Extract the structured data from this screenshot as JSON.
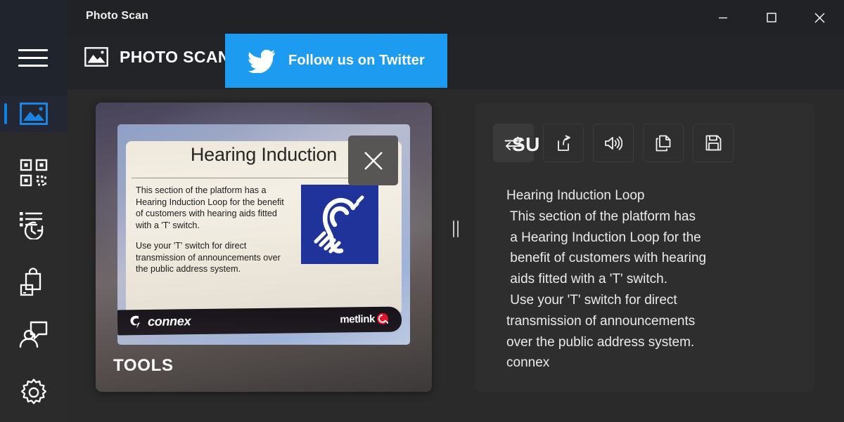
{
  "window": {
    "title": "Photo Scan",
    "controls": [
      {
        "name": "minimize",
        "glyph": "minimize-icon"
      },
      {
        "name": "maximize",
        "glyph": "maximize-icon"
      },
      {
        "name": "close",
        "glyph": "close-icon"
      }
    ]
  },
  "colors": {
    "accent_blue": "#0a84e0",
    "twitter_blue": "#1d9bf0",
    "rail_bg": "#1f232b",
    "rail_bottom_bg": "#2b2b2b",
    "titlebar_bg": "#202225",
    "header_bg": "#222428",
    "work_bg": "#2a2a2a",
    "panel_bg": "#2e2e2e",
    "sign_logo_blue": "#20339a",
    "metlink_red": "#e2142a"
  },
  "sidebar": {
    "menu_button": "hamburger-menu",
    "items": [
      {
        "id": "photo",
        "icon": "image-icon",
        "label": "Photo Scan",
        "selected": true
      },
      {
        "id": "qr",
        "icon": "qr-code-icon",
        "label": "QR Code",
        "selected": false
      },
      {
        "id": "history",
        "icon": "history-clock-icon",
        "label": "History",
        "selected": false
      },
      {
        "id": "store",
        "icon": "shopping-bag-icon",
        "label": "Store",
        "selected": false
      },
      {
        "id": "feedback",
        "icon": "person-feedback-icon",
        "label": "Feedback",
        "selected": false
      },
      {
        "id": "settings",
        "icon": "gear-icon",
        "label": "Settings",
        "selected": false
      }
    ]
  },
  "header": {
    "app_icon": "image-icon",
    "app_name": "PHOTO SCAN",
    "promo": {
      "icon": "twitter-bird-icon",
      "label": "Follow us on Twitter"
    }
  },
  "photo_panel": {
    "tools_label": "TOOLS",
    "close_button": "close-icon",
    "sign": {
      "title": "Hearing Induction",
      "paragraphs": [
        "This section of the platform has a Hearing Induction Loop for the benefit of customers with hearing aids fitted with a 'T' switch.",
        "Use your 'T' switch for direct transmission of announcements over the public address system."
      ],
      "logo_icon": "hearing-loop-ear-icon",
      "brand_left": "connex",
      "brand_right": "metlink"
    }
  },
  "splitter": {
    "name": "panel-splitter-handle"
  },
  "result_panel": {
    "toolbar": [
      {
        "id": "translate",
        "icon": "swap-arrows-icon",
        "label": "Translate",
        "active": true
      },
      {
        "id": "share",
        "icon": "share-icon",
        "label": "Share",
        "active": false
      },
      {
        "id": "speak",
        "icon": "speaker-icon",
        "label": "Read aloud",
        "active": false
      },
      {
        "id": "copy",
        "icon": "copy-icon",
        "label": "Copy",
        "active": false
      },
      {
        "id": "save",
        "icon": "save-disk-icon",
        "label": "Save",
        "active": false
      }
    ],
    "overlay_text": "SU",
    "recognized_lines": [
      "Hearing Induction Loop",
      " This section of the platform has",
      " a Hearing Induction Loop for the",
      " benefit of customers with hearing",
      " aids fitted with a 'T' switch.",
      " Use your 'T' switch for direct",
      "transmission of announcements",
      "over the public address system.",
      "connex"
    ]
  }
}
